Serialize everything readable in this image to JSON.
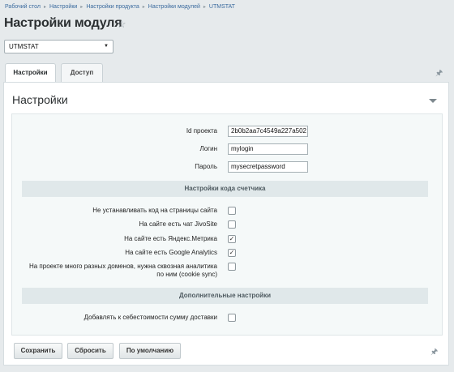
{
  "breadcrumb": [
    "Рабочий стол",
    "Настройки",
    "Настройки продукта",
    "Настройки модулей",
    "UTMSTAT"
  ],
  "breadcrumb_sep": "▸",
  "page_title": "Настройки модуля",
  "star_icon": "☆",
  "module_select": {
    "value": "UTMSTAT",
    "caret": "▼"
  },
  "tabs": [
    {
      "label": "Настройки",
      "active": true
    },
    {
      "label": "Доступ",
      "active": false
    }
  ],
  "pin_icon": "🖈",
  "panel": {
    "title": "Настройки",
    "fields": [
      {
        "label": "Id проекта",
        "value": "2b0b2aa7c4549a227a502"
      },
      {
        "label": "Логин",
        "value": "mylogin"
      },
      {
        "label": "Пароль",
        "value": "mysecretpassword"
      }
    ],
    "section_counter": "Настройки кода счетчика",
    "counter_options": [
      {
        "label": "Не устанавливать код на страницы сайта",
        "checked": false
      },
      {
        "label": "На сайте есть чат JivoSite",
        "checked": false
      },
      {
        "label": "На сайте есть Яндекс.Метрика",
        "checked": true
      },
      {
        "label": "На сайте есть Google Analytics",
        "checked": true
      },
      {
        "label_line1": "На проекте много разных доменов, нужна сквозная аналитика",
        "label_line2": "по ним (cookie sync)",
        "checked": false
      }
    ],
    "section_extra": "Дополнительные настройки",
    "extra_options": [
      {
        "label": "Добавлять к себестоимости сумму доставки",
        "checked": false
      }
    ]
  },
  "footer": {
    "save": "Сохранить",
    "reset": "Сбросить",
    "default": "По умолчанию"
  }
}
